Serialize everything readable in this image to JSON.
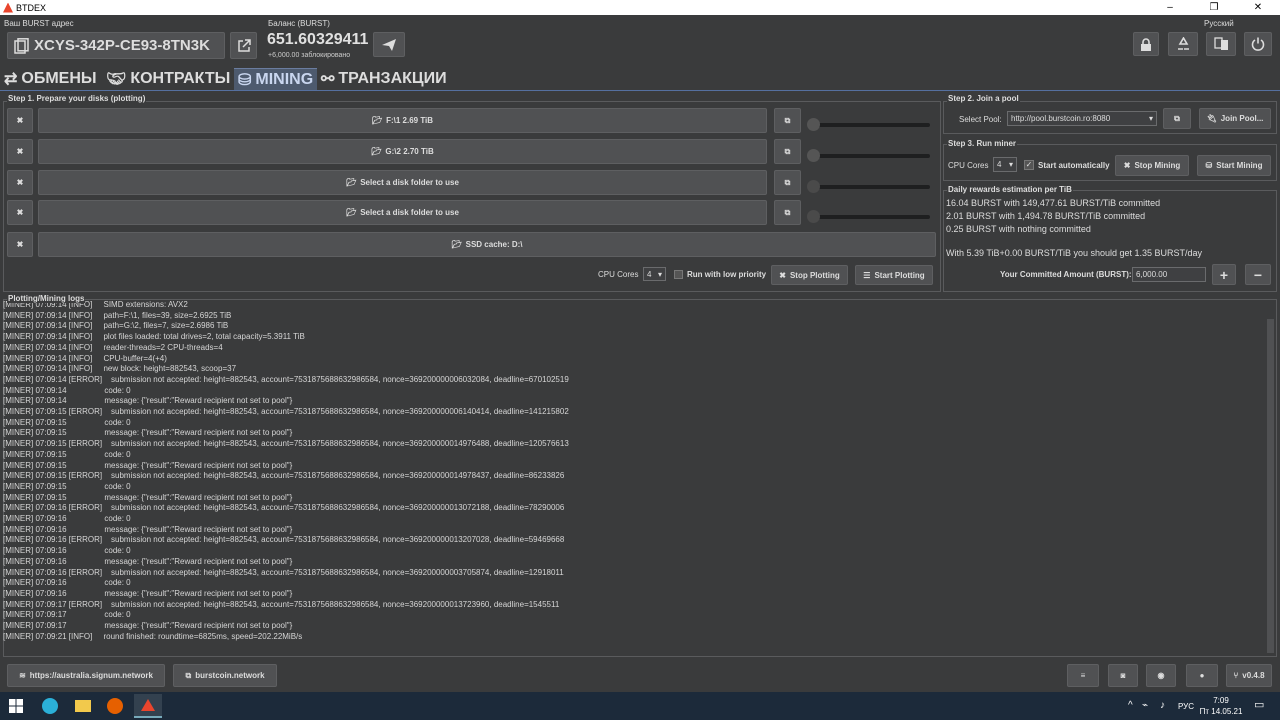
{
  "window": {
    "title": "BTDEX",
    "controls": [
      "–",
      "❐",
      "✕"
    ]
  },
  "header": {
    "address_label": "Ваш BURST адрес",
    "address": "XCYS-342P-CE93-8TN3K",
    "balance_label": "Баланс (BURST)",
    "balance": "651.60329411",
    "locked": "+6,000.00 заблокировано",
    "language": "Русский"
  },
  "tabs": [
    {
      "label": "ОБМЕНЫ",
      "icon": "shuffle-icon"
    },
    {
      "label": "КОНТРАКТЫ",
      "icon": "handshake-icon"
    },
    {
      "label": "MINING",
      "icon": "drive-icon"
    },
    {
      "label": "ТРАНЗАКЦИИ",
      "icon": "link-icon"
    }
  ],
  "step1": {
    "title": "Step 1. Prepare your disks (plotting)",
    "disks": [
      {
        "label": "F:\\1 2.69 TiB"
      },
      {
        "label": "G:\\2 2.70 TiB"
      },
      {
        "label": "Select a disk folder to use"
      },
      {
        "label": "Select a disk folder to use"
      }
    ],
    "ssd": "SSD cache: D:\\",
    "cpu_label": "CPU Cores",
    "cpu_value": "4",
    "low_priority": "Run with low priority",
    "stop_plotting": "Stop Plotting",
    "start_plotting": "Start Plotting"
  },
  "step2": {
    "title": "Step 2. Join a pool",
    "select_label": "Select Pool:",
    "pool": "http://pool.burstcoin.ro:8080",
    "join": "Join Pool..."
  },
  "step3": {
    "title": "Step 3. Run miner",
    "cpu_label": "CPU Cores",
    "cpu_value": "4",
    "auto": "Start automatically",
    "stop": "Stop Mining",
    "start": "Start Mining"
  },
  "rewards": {
    "title": "Daily rewards estimation per TiB",
    "lines": [
      "16.04 BURST with 149,477.61 BURST/TiB committed",
      "2.01 BURST with 1,494.78 BURST/TiB committed",
      "0.25 BURST with nothing committed"
    ],
    "summary": "With 5.39 TiB+0.00 BURST/TiB you should get 1.35 BURST/day",
    "committed_label": "Your Committed Amount (BURST):",
    "committed_value": "6,000.00"
  },
  "logs": {
    "title": "Plotting/Mining logs",
    "lines": [
      "[MINER] 07:09:14 [INFO]     SIMD extensions: AVX2",
      "[MINER] 07:09:14 [INFO]     path=F:\\1, files=39, size=2.6925 TiB",
      "[MINER] 07:09:14 [INFO]     path=G:\\2, files=7, size=2.6986 TiB",
      "[MINER] 07:09:14 [INFO]     plot files loaded: total drives=2, total capacity=5.3911 TiB",
      "[MINER] 07:09:14 [INFO]     reader-threads=2 CPU-threads=4",
      "[MINER] 07:09:14 [INFO]     CPU-buffer=4(+4)",
      "[MINER] 07:09:14 [INFO]     new block: height=882543, scoop=37",
      "[MINER] 07:09:14 [ERROR]    submission not accepted: height=882543, account=7531875688632986584, nonce=369200000006032084, deadline=670102519",
      "[MINER] 07:09:14                 code: 0",
      "[MINER] 07:09:14                 message: {\"result\":\"Reward recipient not set to pool\"}",
      "[MINER] 07:09:15 [ERROR]    submission not accepted: height=882543, account=7531875688632986584, nonce=369200000006140414, deadline=141215802",
      "[MINER] 07:09:15                 code: 0",
      "[MINER] 07:09:15                 message: {\"result\":\"Reward recipient not set to pool\"}",
      "[MINER] 07:09:15 [ERROR]    submission not accepted: height=882543, account=7531875688632986584, nonce=369200000014976488, deadline=120576613",
      "[MINER] 07:09:15                 code: 0",
      "[MINER] 07:09:15                 message: {\"result\":\"Reward recipient not set to pool\"}",
      "[MINER] 07:09:15 [ERROR]    submission not accepted: height=882543, account=7531875688632986584, nonce=369200000014978437, deadline=86233826",
      "[MINER] 07:09:15                 code: 0",
      "[MINER] 07:09:15                 message: {\"result\":\"Reward recipient not set to pool\"}",
      "[MINER] 07:09:16 [ERROR]    submission not accepted: height=882543, account=7531875688632986584, nonce=369200000013072188, deadline=78290006",
      "[MINER] 07:09:16                 code: 0",
      "[MINER] 07:09:16                 message: {\"result\":\"Reward recipient not set to pool\"}",
      "[MINER] 07:09:16 [ERROR]    submission not accepted: height=882543, account=7531875688632986584, nonce=369200000013207028, deadline=59469668",
      "[MINER] 07:09:16                 code: 0",
      "[MINER] 07:09:16                 message: {\"result\":\"Reward recipient not set to pool\"}",
      "[MINER] 07:09:16 [ERROR]    submission not accepted: height=882543, account=7531875688632986584, nonce=369200000003705874, deadline=12918011",
      "[MINER] 07:09:16                 code: 0",
      "[MINER] 07:09:16                 message: {\"result\":\"Reward recipient not set to pool\"}",
      "[MINER] 07:09:17 [ERROR]    submission not accepted: height=882543, account=7531875688632986584, nonce=369200000013723960, deadline=1545511",
      "[MINER] 07:09:17                 code: 0",
      "[MINER] 07:09:17                 message: {\"result\":\"Reward recipient not set to pool\"}",
      "[MINER] 07:09:21 [INFO]     round finished: roundtime=6825ms, speed=202.22MiB/s"
    ]
  },
  "footer": {
    "node": "https://australia.signum.network",
    "site": "burstcoin.network",
    "version": "v0.4.8"
  },
  "taskbar": {
    "lang": "РУС",
    "time": "7:09",
    "date": "Пт 14.05.21"
  }
}
